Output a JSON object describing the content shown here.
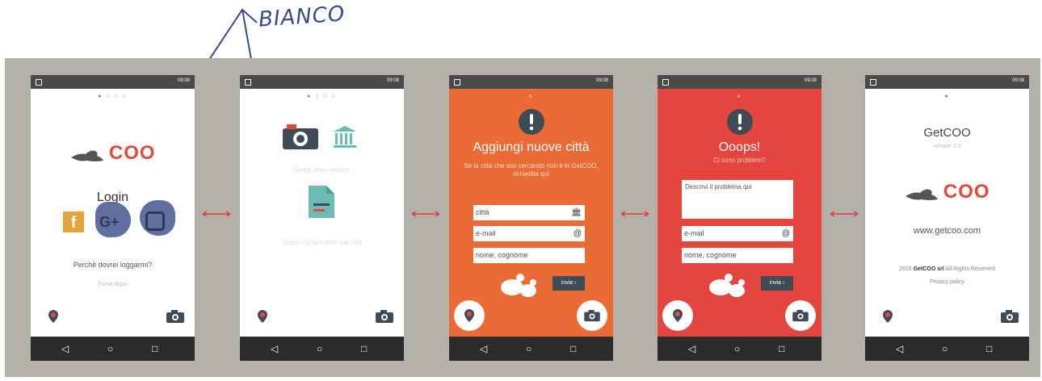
{
  "annotation": {
    "text": "BIANCO"
  },
  "status_time": "09:08",
  "colors": {
    "orange": "#ea6b35",
    "red": "#e5453f",
    "white": "#ffffff",
    "dark": "#2b2b2b",
    "teal": "#6cbcb5",
    "accent": "#e24b3b"
  },
  "icons": [
    "pigeon-icon",
    "facebook-icon",
    "google-plus-icon",
    "instagram-icon",
    "camera-icon",
    "museum-icon",
    "document-icon",
    "map-pin-icon",
    "exclamation-icon",
    "city-icon",
    "at-icon",
    "back-icon",
    "home-icon",
    "recents-icon"
  ],
  "nav": {
    "back": "◁",
    "home": "○",
    "recents": "□"
  },
  "screen1": {
    "logo_text": "COO",
    "title": "Login",
    "facebook": "f",
    "google": "G+",
    "why_link": "Perchè dovrei loggarmi?",
    "skip_link": "Forse dopo"
  },
  "screen2": {
    "caption1": "Scegli dove visitare",
    "caption2": "Scopri i luoghi della tua città"
  },
  "screen3": {
    "title": "Aggiungi nuove città",
    "subtitle": "Se la città che stai cercando non è in GetCOO, richiedila qui",
    "city_placeholder": "città",
    "email_placeholder": "e-mail",
    "name_placeholder": "nome, cognome",
    "send_label": "invia ›"
  },
  "screen4": {
    "title": "Ooops!",
    "subtitle": "Ci sono problemi?",
    "problem_placeholder": "Descrivi il problema qui",
    "email_placeholder": "e-mail",
    "name_placeholder": "nome, cognome",
    "send_label": "invia ›"
  },
  "screen5": {
    "app_name": "GetCOO",
    "version": "version 1.0",
    "logo_text": "COO",
    "website": "www.getcoo.com",
    "copyright_pre": "2016",
    "company": "GetCOO srl",
    "rights": "All Rights Reserved",
    "privacy": "Privacy policy"
  }
}
